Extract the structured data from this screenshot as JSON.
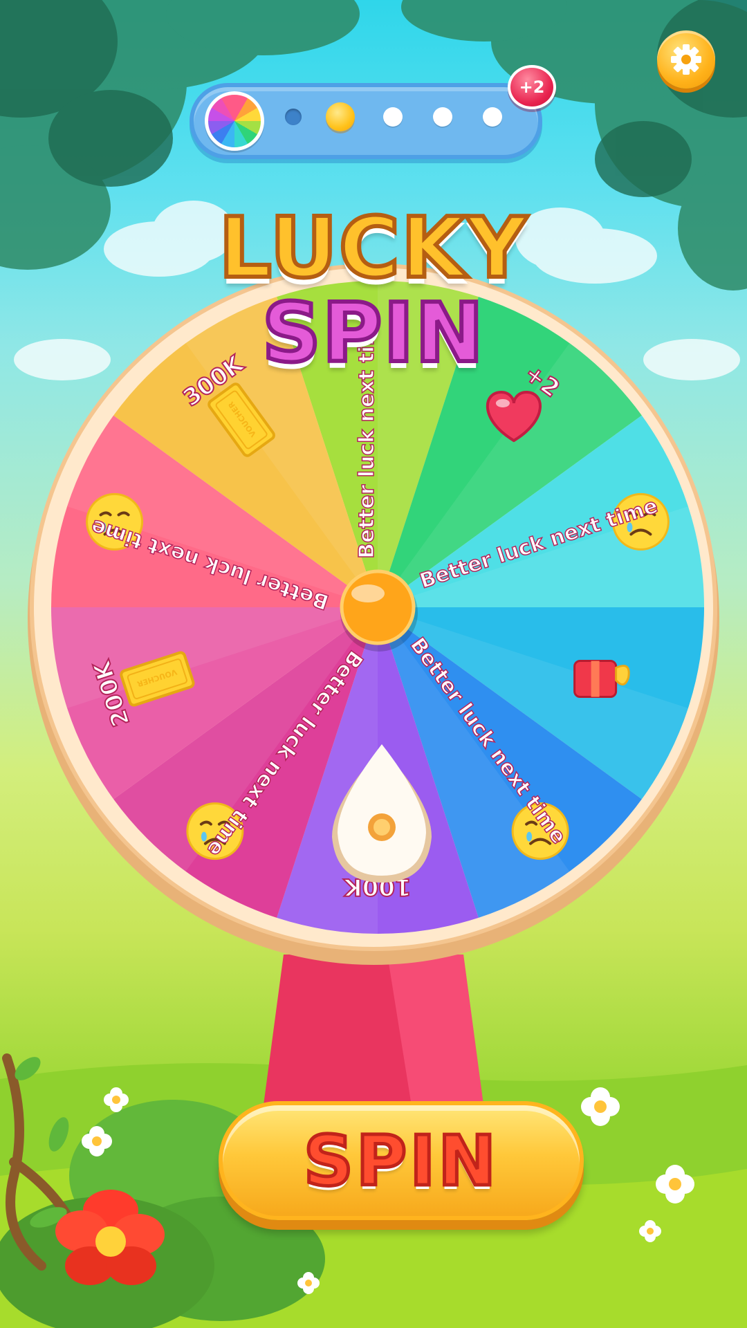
{
  "header": {
    "stage_dots": [
      {
        "state": "done"
      },
      {
        "state": "current"
      },
      {
        "state": "todo"
      },
      {
        "state": "todo"
      },
      {
        "state": "todo"
      }
    ],
    "bonus_badge": "+2",
    "settings_icon": "gear-icon"
  },
  "title": {
    "line1": "LUCKY",
    "line2": "SPIN"
  },
  "wheel": {
    "segments": [
      {
        "label": "Better luck next time",
        "icon": "",
        "color": "#a6df3e"
      },
      {
        "label": "+2",
        "icon": "heart-icon",
        "color": "#32d47a"
      },
      {
        "label": "Better luck next time",
        "icon": "sad-face-icon",
        "color": "#4fdfe6"
      },
      {
        "label": "",
        "icon": "gift-box-icon",
        "color": "#29bdea"
      },
      {
        "label": "Better luck next time",
        "icon": "sad-face-icon",
        "color": "#2f8ff0"
      },
      {
        "label": "100K",
        "icon": "voucher-icon",
        "color": "#9b5cf0"
      },
      {
        "label": "Better luck next time",
        "icon": "sad-face-icon",
        "color": "#de3f99"
      },
      {
        "label": "200K",
        "icon": "voucher-icon",
        "color": "#ea5fa8"
      },
      {
        "label": "Better luck next time",
        "icon": "sad-face-icon",
        "color": "#ff6a88"
      },
      {
        "label": "300K",
        "icon": "voucher-icon",
        "color": "#f7c34a"
      }
    ],
    "voucher_text": "VOUCHER"
  },
  "spin_button": {
    "label": "SPIN"
  },
  "colors": {
    "accent_yellow": "#ffc12c",
    "accent_pink": "#e45bd8",
    "spin_red": "#ff4d2f"
  }
}
